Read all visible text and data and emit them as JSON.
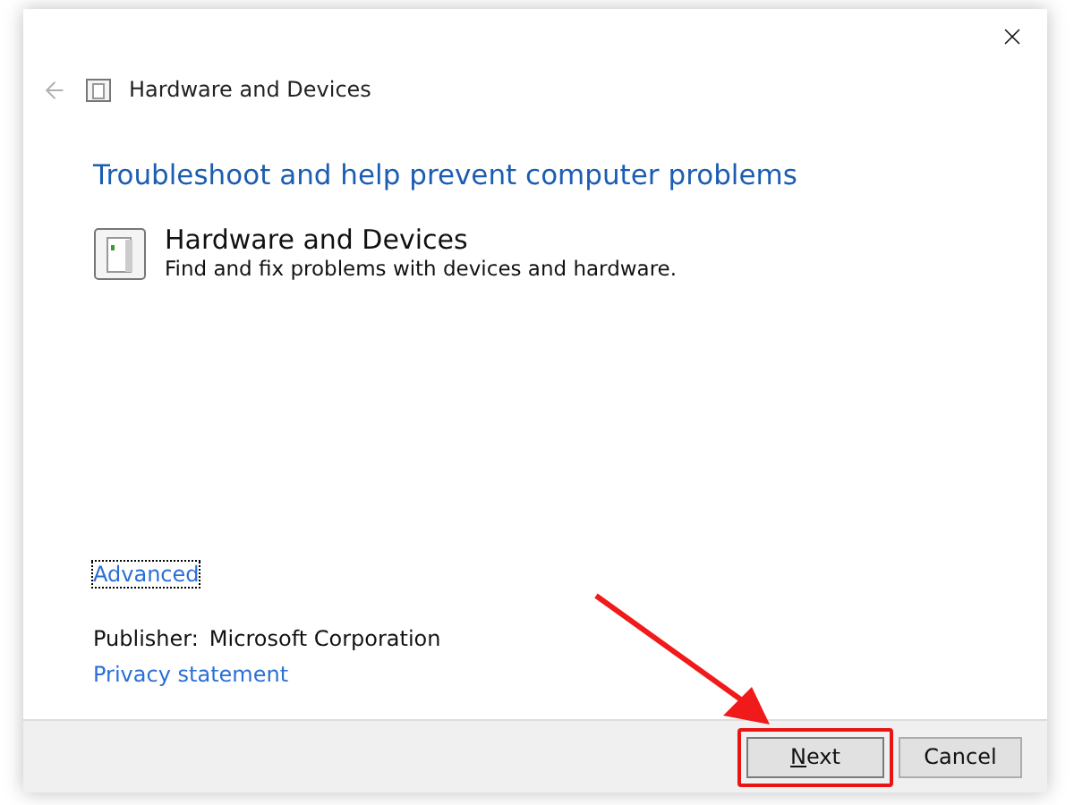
{
  "header": {
    "back_disabled": true,
    "title": "Hardware and Devices"
  },
  "heading": "Troubleshoot and help prevent computer problems",
  "troubleshooter": {
    "title": "Hardware and Devices",
    "description": "Find and fix problems with devices and hardware."
  },
  "advanced_link": {
    "label": "Advanced",
    "focused": true
  },
  "publisher": {
    "label": "Publisher:",
    "value": "Microsoft Corporation"
  },
  "privacy_link": "Privacy statement",
  "buttons": [
    {
      "label": "Next",
      "default": true,
      "highlighted": true
    },
    {
      "label": "Cancel",
      "default": false,
      "highlighted": false
    }
  ]
}
